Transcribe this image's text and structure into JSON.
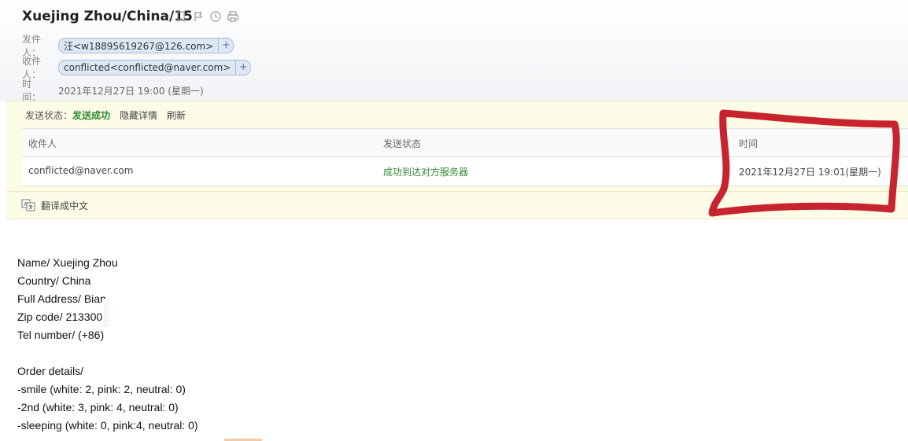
{
  "email": {
    "subject": "Xuejing Zhou/China/15",
    "toolbar_icons": [
      "bookmark-icon",
      "flag-icon",
      "clock-icon",
      "print-icon"
    ],
    "sender": {
      "label": "发件人：",
      "value": "汪<w18895619267@126.com>",
      "add": "+"
    },
    "recipient": {
      "label": "收件人：",
      "value": "conflicted<conflicted@naver.com>",
      "add": "+"
    },
    "time": {
      "label": "时　间：",
      "value": "2021年12月27日 19:00 (星期一)"
    }
  },
  "send_status": {
    "label": "发送状态：",
    "status": "发送成功",
    "hide_details": "隐藏详情",
    "refresh": "刷新",
    "columns": [
      "收件人",
      "发送状态",
      "时间"
    ],
    "rows": [
      {
        "recipient": "conflicted@naver.com",
        "status": "成功到达对方服务器",
        "time": "2021年12月27日 19:01(星期一)"
      }
    ],
    "status_color": "#2f8a2f"
  },
  "translate": {
    "label": "翻译成中文",
    "icon": "translate-icon"
  },
  "annotation": {
    "color": "#c8242f"
  },
  "body": {
    "lines": [
      "Name/ Xuejing Zhou",
      "Country/ China",
      "Full Address/ Bian",
      "Zip code/ 213300",
      "Tel number/ (+86)",
      "",
      "Order details/",
      "-smile (white: 2, pink: 2, neutral: 0)",
      "-2nd (white: 3, pink: 4, neutral: 0)",
      "-sleeping (white: 0, pink:4, neutral: 0)"
    ]
  }
}
